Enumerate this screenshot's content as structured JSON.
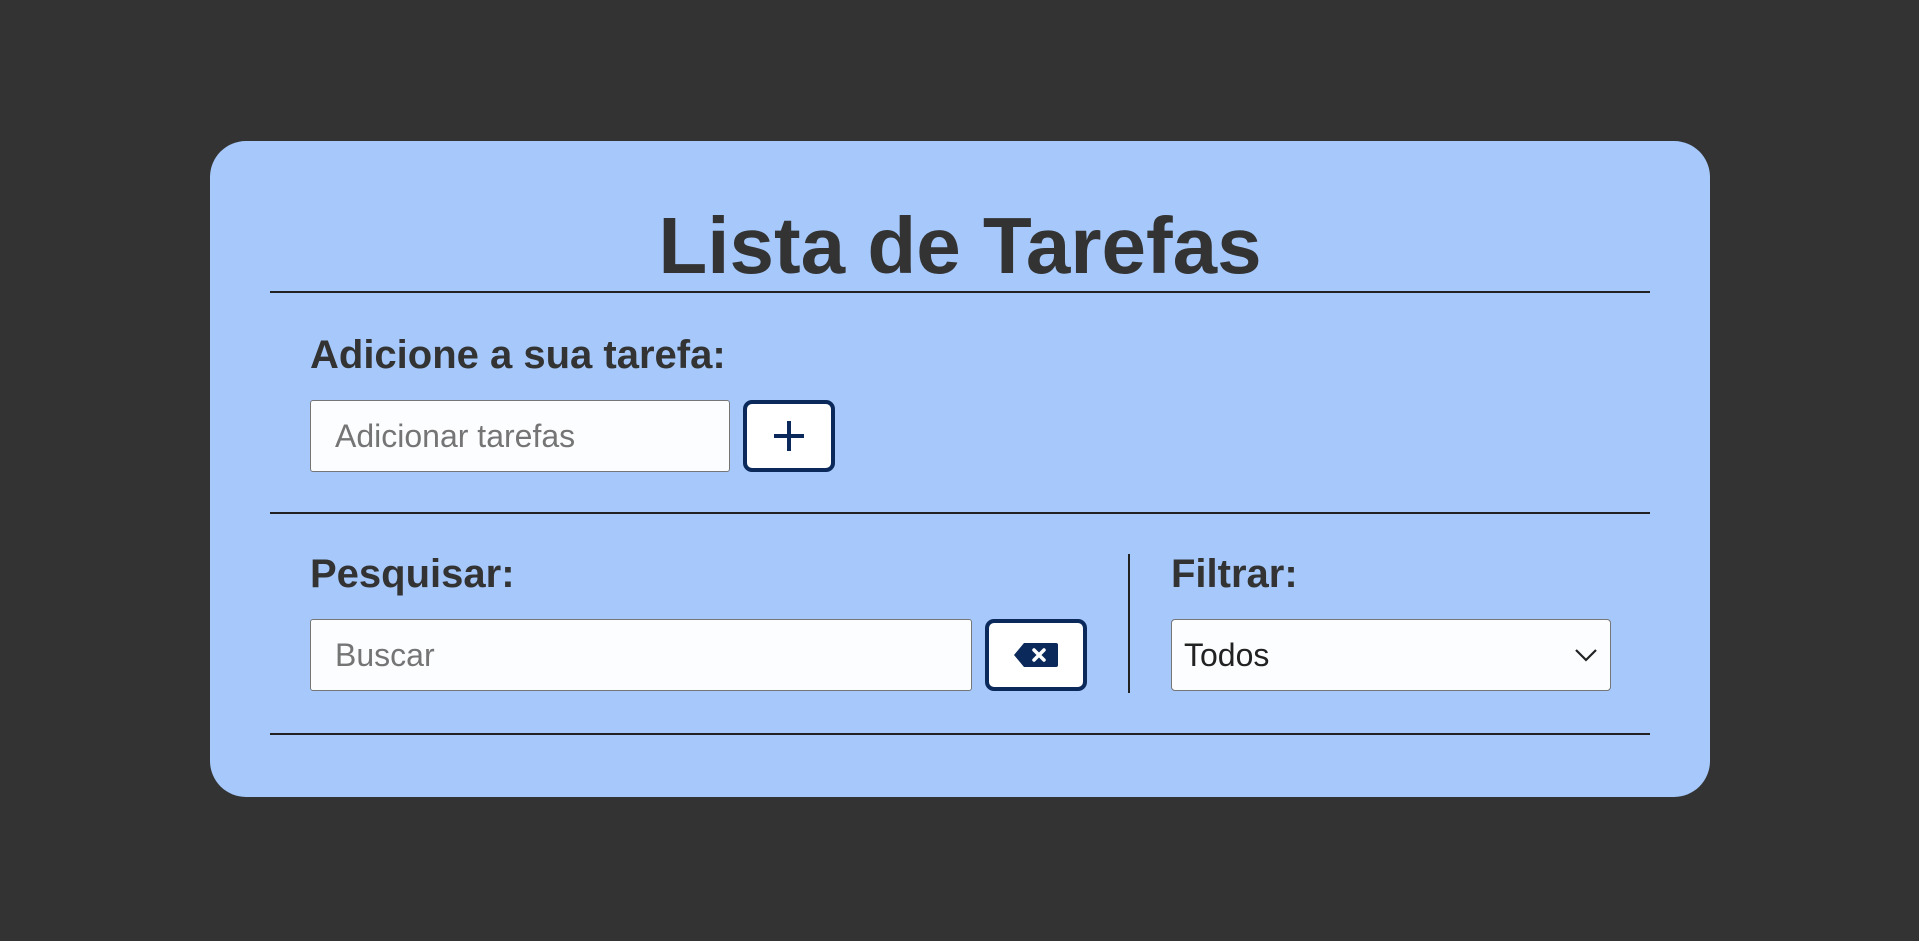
{
  "header": {
    "title": "Lista de Tarefas"
  },
  "add_task": {
    "label": "Adicione a sua tarefa:",
    "input_placeholder": "Adicionar tarefas",
    "input_value": "",
    "add_button_icon": "plus-icon"
  },
  "search": {
    "label": "Pesquisar:",
    "input_placeholder": "Buscar",
    "input_value": "",
    "clear_button_icon": "backspace-icon"
  },
  "filter": {
    "label": "Filtrar:",
    "selected": "Todos",
    "dropdown_icon": "chevron-down-icon"
  },
  "colors": {
    "page_background": "#333333",
    "card_background": "#a6c8fa",
    "button_border": "#0b2a5b",
    "text": "#333333"
  }
}
